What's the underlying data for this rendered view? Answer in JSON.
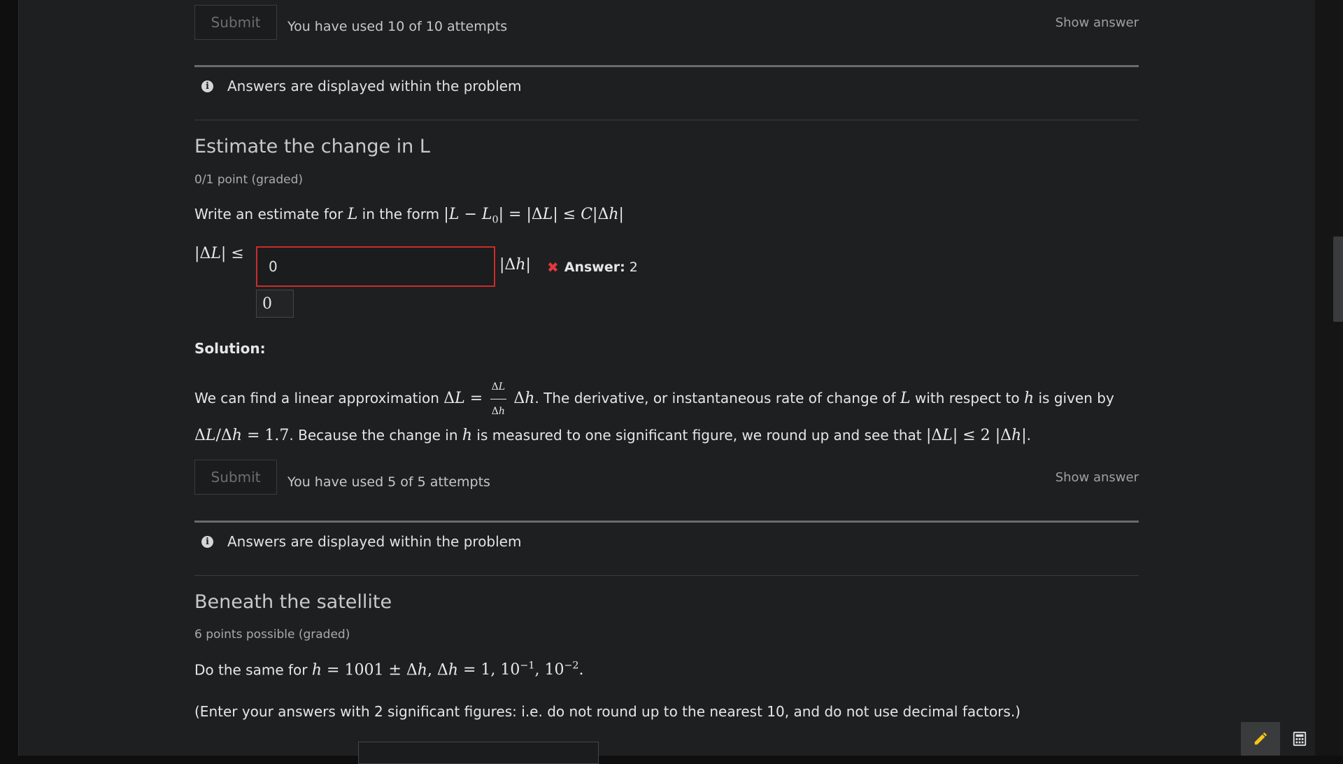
{
  "top_block": {
    "submit_label": "Submit",
    "attempts_text": "You have used 10 of 10 attempts",
    "show_answer_label": "Show answer",
    "notice_text": "Answers are displayed within the problem"
  },
  "problem_change": {
    "title": "Estimate the change in L",
    "points": "0/1 point (graded)",
    "prompt_prefix": "Write an estimate for",
    "prompt_var": "L",
    "prompt_mid": "in the form",
    "input_value": "0",
    "preview_value": "0",
    "answer_label": "Answer:",
    "answer_value": "2",
    "solution_heading": "Solution:",
    "solution": {
      "s1": "We can find a linear approximation",
      "s2": ". The derivative, or instantaneous rate of change of",
      "s3": "with respect to",
      "s4": "is given by",
      "s5": ". Because the change in",
      "s6": "is measured to one significant figure, we round up and see that",
      "s7": "."
    },
    "submit_label": "Submit",
    "attempts_text": "You have used 5 of 5 attempts",
    "show_answer_label": "Show answer",
    "notice_text": "Answers are displayed within the problem"
  },
  "problem_satellite": {
    "title": "Beneath the satellite",
    "points": "6 points possible (graded)",
    "prompt_prefix": "Do the same for",
    "instructions": "(Enter your answers with 2 significant figures: i.e. do not round up to the nearest 10, and do not use decimal factors.)"
  },
  "toolbar": {
    "notes_icon": "pencil-icon",
    "calculator_icon": "calculator-icon"
  },
  "colors": {
    "background": "#1e1f20",
    "error": "#cc2b2b",
    "tool_highlight": "#3a3b3c",
    "pencil": "#f5c518"
  }
}
